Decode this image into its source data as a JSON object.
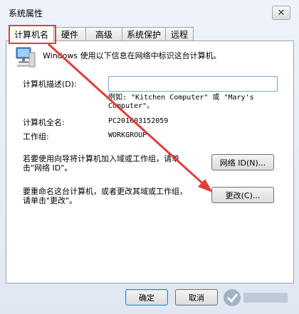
{
  "window": {
    "title": "系统属性",
    "close_icon": "✕"
  },
  "tabs": [
    {
      "label": "计算机名",
      "active": true
    },
    {
      "label": "硬件"
    },
    {
      "label": "高级"
    },
    {
      "label": "系统保护"
    },
    {
      "label": "远程"
    }
  ],
  "panel": {
    "intro": "Windows 使用以下信息在网络中标识这台计算机。",
    "description_label": "计算机描述(D):",
    "description_value": "",
    "example": "例如: \"Kitchen Computer\" 或 \"Mary's Computer\"。",
    "fullname_label": "计算机全名:",
    "fullname_value": "PC201603152059",
    "workgroup_label": "工作组:",
    "workgroup_value": "WORKGROUP",
    "network_hint": "若要使用向导将计算机加入域或工作组，请单击\"网络 ID\"。",
    "network_button": "网络 ID(N)...",
    "rename_hint": "要重命名这台计算机，或者更改其域或工作组，请单击\"更改\"。",
    "change_button": "更改(C)..."
  },
  "footer": {
    "ok_button": "确定",
    "cancel_button": "取消"
  },
  "colors": {
    "annotation": "#e23d3d",
    "accent": "#3c7fb1"
  },
  "watermark": {
    "text": "系统之家"
  }
}
